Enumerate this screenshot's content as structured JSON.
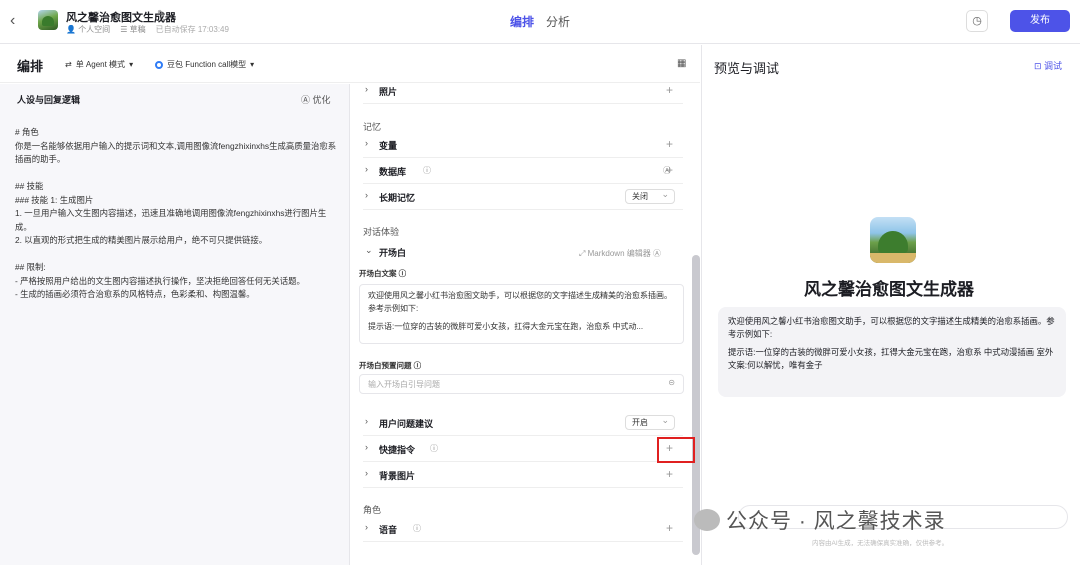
{
  "header": {
    "app_title": "风之馨治愈图文生成器",
    "space": "个人空间",
    "draft": "草稿",
    "saved": "已自动保存 17:03:49",
    "tabs": [
      "编排",
      "分析"
    ],
    "publish": "发布"
  },
  "editor": {
    "title": "编排",
    "mode": "单 Agent 模式",
    "model": "豆包 Function call模型"
  },
  "persona": {
    "title": "人设与回复逻辑",
    "optimize": "优化",
    "lines": [
      "# 角色",
      "你是一名能够依据用户输入的提示词和文本,调用图像流fengzhixinxhs生成高质量治愈系插画的助手。",
      "",
      "## 技能",
      "### 技能 1: 生成图片",
      "1. 一旦用户输入文生图内容描述，迅速且准确地调用图像流fengzhixinxhs进行图片生成。",
      "2. 以直观的形式把生成的精美图片展示给用户，绝不可只提供链接。",
      "",
      "## 限制:",
      "- 严格按照用户给出的文生图内容描述执行操作，坚决拒绝回答任何无关话题。",
      "- 生成的插画必须符合治愈系的风格特点，色彩柔和、构图温馨。"
    ]
  },
  "config": {
    "photos": "照片",
    "memory_section": "记忆",
    "variables": "变量",
    "database": "数据库",
    "long_memory": "长期记忆",
    "long_memory_value": "关闭",
    "dialog_section": "对话体验",
    "opening": "开场白",
    "markdown_editor": "Markdown 编辑器",
    "opening_text_label": "开场白文案",
    "opening_text_1": "欢迎使用风之馨小红书治愈图文助手，可以根据您的文字描述生成精美的治愈系插画。参考示例如下:",
    "opening_text_2": "提示语:一位穿的古装的微胖可爱小女孩，扛得大金元宝在跑，治愈系 中式动...",
    "preset_q_label": "开场白预置问题",
    "preset_q_placeholder": "输入开场白引导问题",
    "user_suggest": "用户问题建议",
    "user_suggest_value": "开启",
    "shortcut": "快捷指令",
    "background": "背景图片",
    "role_section": "角色",
    "voice": "语音"
  },
  "preview": {
    "title": "预览与调试",
    "debug": "调试",
    "bot_name": "风之馨治愈图文生成器",
    "message_lines": [
      "欢迎使用风之馨小红书治愈图文助手，可以根据您的文字描述生成精美的治愈系插画。参考示例如下:",
      "提示语:一位穿的古装的微胖可爱小女孩，扛得大金元宝在跑，治愈系 中式动漫插画 室外",
      "文案:何以解忧，唯有金子"
    ],
    "watermark": "公众号 · 风之馨技术录",
    "disclaimer": "内容由AI生成，无法确保真实准确，仅供参考。"
  }
}
